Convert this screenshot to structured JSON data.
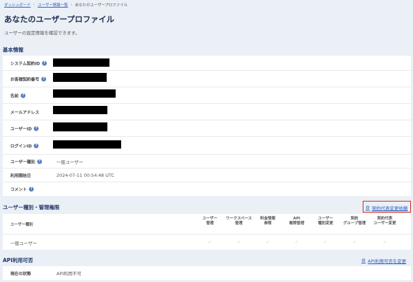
{
  "breadcrumb": {
    "items": [
      "ダッシュボード",
      "ユーザー情報一覧",
      "あなたのユーザープロファイル"
    ],
    "separator": "›"
  },
  "page": {
    "title": "あなたのユーザープロファイル",
    "subtitle": "ユーザーの設定情報を確認できます。"
  },
  "basic_info": {
    "title": "基本情報",
    "rows": [
      {
        "label": "システム契約ID",
        "value": "",
        "help": true
      },
      {
        "label": "お客様契約番号",
        "value": "",
        "help": true
      },
      {
        "label": "名前",
        "value": "",
        "help": true
      },
      {
        "label": "メールアドレス",
        "value": "",
        "help": false
      },
      {
        "label": "ユーザーID",
        "value": "",
        "help": true
      },
      {
        "label": "ログインID",
        "value": "",
        "help": true
      },
      {
        "label": "ユーザー種別",
        "value": "一般ユーザー",
        "help": true
      },
      {
        "label": "利用開始日",
        "value": "2024-07-11 00:54:48 UTC",
        "help": false
      },
      {
        "label": "コメント",
        "value": "",
        "help": true
      }
    ]
  },
  "permissions": {
    "title": "ユーザー種別・管理権限",
    "action_label": "契約代表変更依頼",
    "row_header": "ユーザー種別",
    "columns": [
      [
        "ユーザー",
        "管理"
      ],
      [
        "ワークスペース",
        "管理"
      ],
      [
        "料金情報",
        "参照"
      ],
      [
        "API",
        "権限管理"
      ],
      [
        "ユーザー",
        "種別変更"
      ],
      [
        "契約",
        "グループ管理"
      ],
      [
        "契約代表",
        "ユーザー変更"
      ]
    ],
    "rows": [
      {
        "label": "一般ユーザー",
        "checks": [
          "✓",
          "✓",
          "✓",
          "✓",
          "✓",
          "✓",
          "✓"
        ]
      }
    ]
  },
  "api_usage": {
    "title": "API利用可否",
    "action_label": "API利用可否を変更",
    "status_label": "現在の状態",
    "status_value": "API利用不可"
  },
  "icons": {
    "help": "question-circle-icon",
    "gear": "gear-icon",
    "check": "check-icon"
  },
  "colors": {
    "background": "#ebeff6",
    "section_title": "#1f3869",
    "link": "#2a5fbd",
    "highlight": "#d9241b",
    "help_icon": "#5a7fc2"
  }
}
